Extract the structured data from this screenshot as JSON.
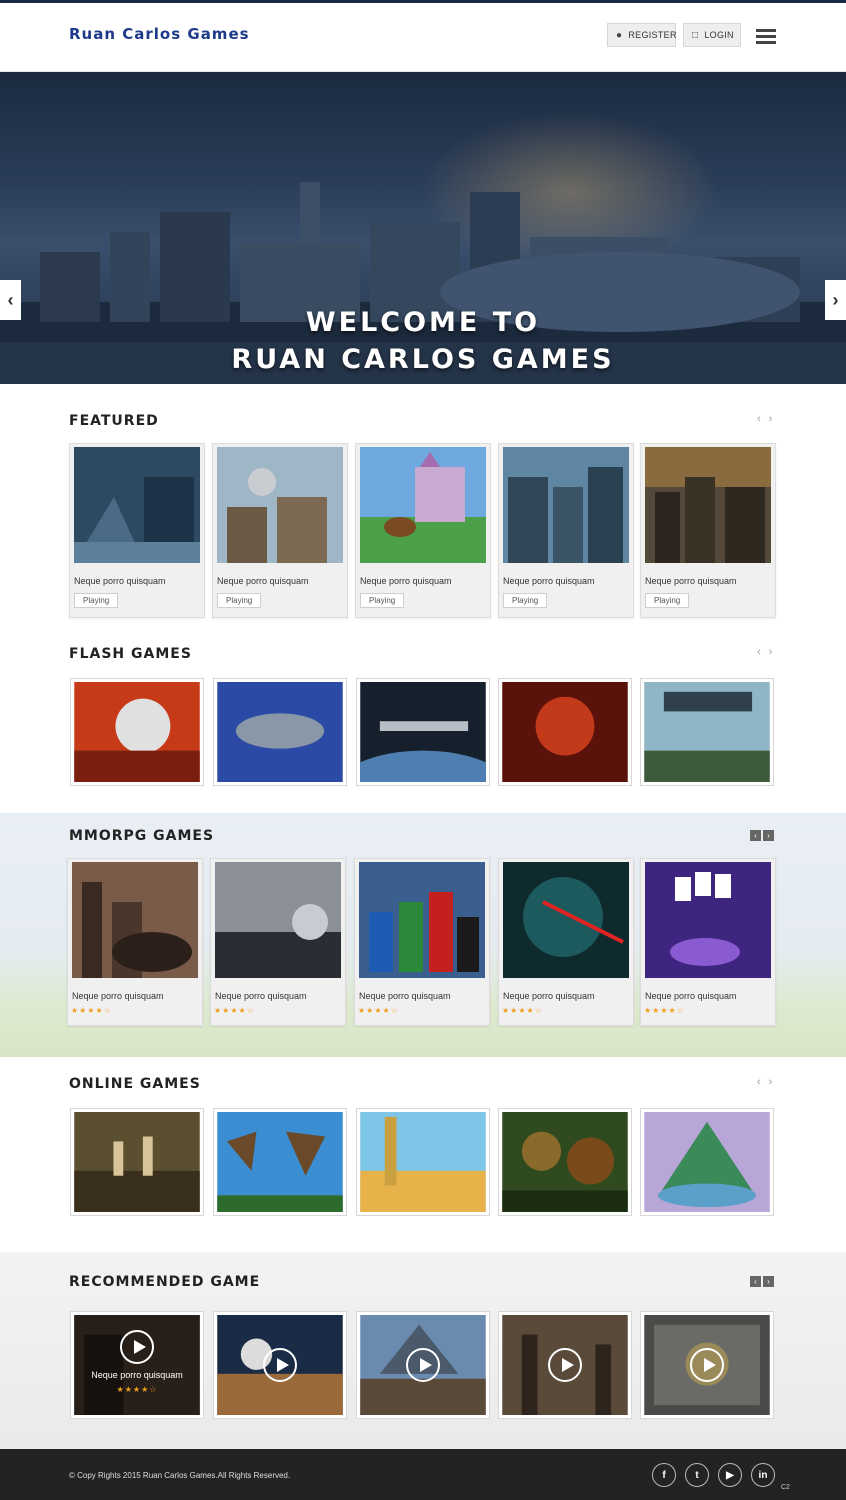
{
  "header": {
    "logo": "Ruan Carlos Games",
    "register_label": "REGISTER",
    "login_label": "LOGIN"
  },
  "hero": {
    "line1": "WELCOME TO",
    "line2": "RUAN CARLOS GAMES",
    "prev": "‹",
    "next": "›"
  },
  "featured": {
    "title": "Featured",
    "items": [
      {
        "title": "Neque porro quisquam",
        "tag": "Playing"
      },
      {
        "title": "Neque porro quisquam",
        "tag": "Playing"
      },
      {
        "title": "Neque porro quisquam",
        "tag": "Playing"
      },
      {
        "title": "Neque porro quisquam",
        "tag": "Playing"
      },
      {
        "title": "Neque porro quisquam",
        "tag": "Playing"
      }
    ]
  },
  "flash": {
    "title": "Flash Games"
  },
  "mmorpg": {
    "title": "MMORPG Games",
    "items": [
      {
        "title": "Neque porro quisquam",
        "stars": "★★★★☆"
      },
      {
        "title": "Neque porro quisquam",
        "stars": "★★★★☆"
      },
      {
        "title": "Neque porro quisquam",
        "stars": "★★★★☆"
      },
      {
        "title": "Neque porro quisquam",
        "stars": "★★★★☆"
      },
      {
        "title": "Neque porro quisquam",
        "stars": "★★★★☆"
      }
    ]
  },
  "online": {
    "title": "Online Games"
  },
  "recommended": {
    "title": "Recommended Game",
    "first": {
      "title": "Neque porro quisquam",
      "stars": "★★★★☆"
    }
  },
  "footer": {
    "copyright": "© Copy Rights 2015 Ruan Carlos Games.All Rights Reserved.",
    "social": [
      "f",
      "t",
      "▶",
      "in"
    ],
    "badge": "C2"
  },
  "nav": {
    "prev": "‹",
    "next": "›"
  },
  "colors": {
    "logo": "#1e3a8a",
    "footer": "#232323",
    "stars": "#f0a020"
  }
}
